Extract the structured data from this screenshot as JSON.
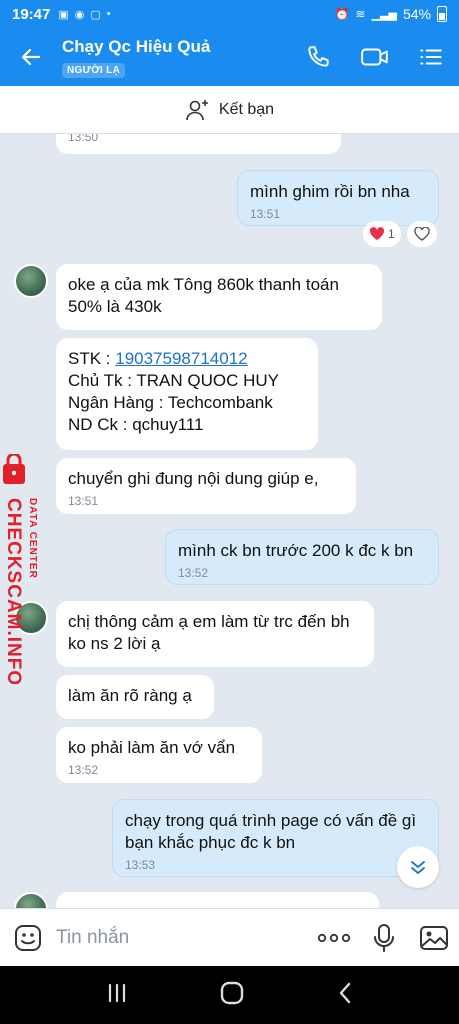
{
  "status_bar": {
    "time": "19:47",
    "battery": "54%"
  },
  "header": {
    "title": "Chạy Qc Hiệu Quả",
    "badge": "NGƯỜI LẠ"
  },
  "friend_bar": {
    "label": "Kết bạn"
  },
  "messages": {
    "m0": {
      "time": "13:50"
    },
    "m1": {
      "text": "mình ghim rồi bn nha",
      "time": "13:51"
    },
    "reaction": {
      "count": "1"
    },
    "m2": {
      "text": "oke ạ của mk Tông 860k thanh toán 50% là 430k"
    },
    "m3": {
      "l1_label": "STK : ",
      "l1_value": "19037598714012",
      "l2": "Chủ Tk : TRAN QUOC HUY",
      "l3": "Ngân Hàng : Techcombank",
      "l4": "ND Ck : qchuy111"
    },
    "m4": {
      "text": "chuyển ghi đung nội dung giúp e,",
      "time": "13:51"
    },
    "m5": {
      "text": "mình ck bn trước 200 k đc k bn",
      "time": "13:52"
    },
    "m6": {
      "text": "chị thông cảm ạ em làm từ trc đến bh ko ns 2 lời ạ"
    },
    "m7": {
      "text": "làm ăn rõ ràng ạ"
    },
    "m8": {
      "text": "ko phải làm ăn vớ vẩn",
      "time": "13:52"
    },
    "m9": {
      "text": "chạy trong quá trình page có vấn đề gì bạn khắc phục đc k bn",
      "time": "13:53"
    }
  },
  "watermark": {
    "line1": "DATA CENTER",
    "line2": "CHECKSCAM.INFO"
  },
  "input": {
    "placeholder": "Tin nhắn"
  },
  "colors": {
    "accent": "#1a8cf0",
    "outgoing_bubble": "#d5ebfc",
    "chat_bg": "#e2e8ef",
    "watermark": "#e0202a"
  }
}
